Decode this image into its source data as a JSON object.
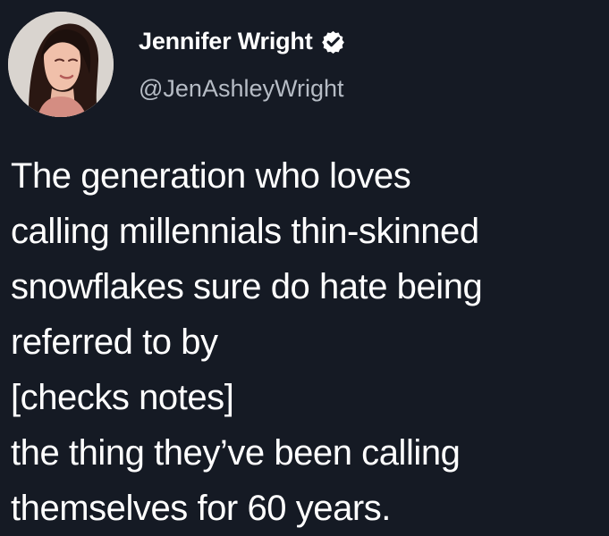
{
  "author": {
    "name": "Jennifer Wright",
    "handle": "@JenAshleyWright",
    "verified_icon": "verified-badge-icon",
    "avatar": "profile-photo"
  },
  "tweet": {
    "lines": [
      "The generation who loves",
      "calling millennials thin-skinned",
      "snowflakes sure do hate being",
      "referred to by",
      "[checks notes]",
      "the thing they’ve been calling",
      "themselves for 60 years."
    ]
  },
  "colors": {
    "background": "#151a24",
    "text": "#ffffff",
    "handle": "#b6bcc5"
  }
}
